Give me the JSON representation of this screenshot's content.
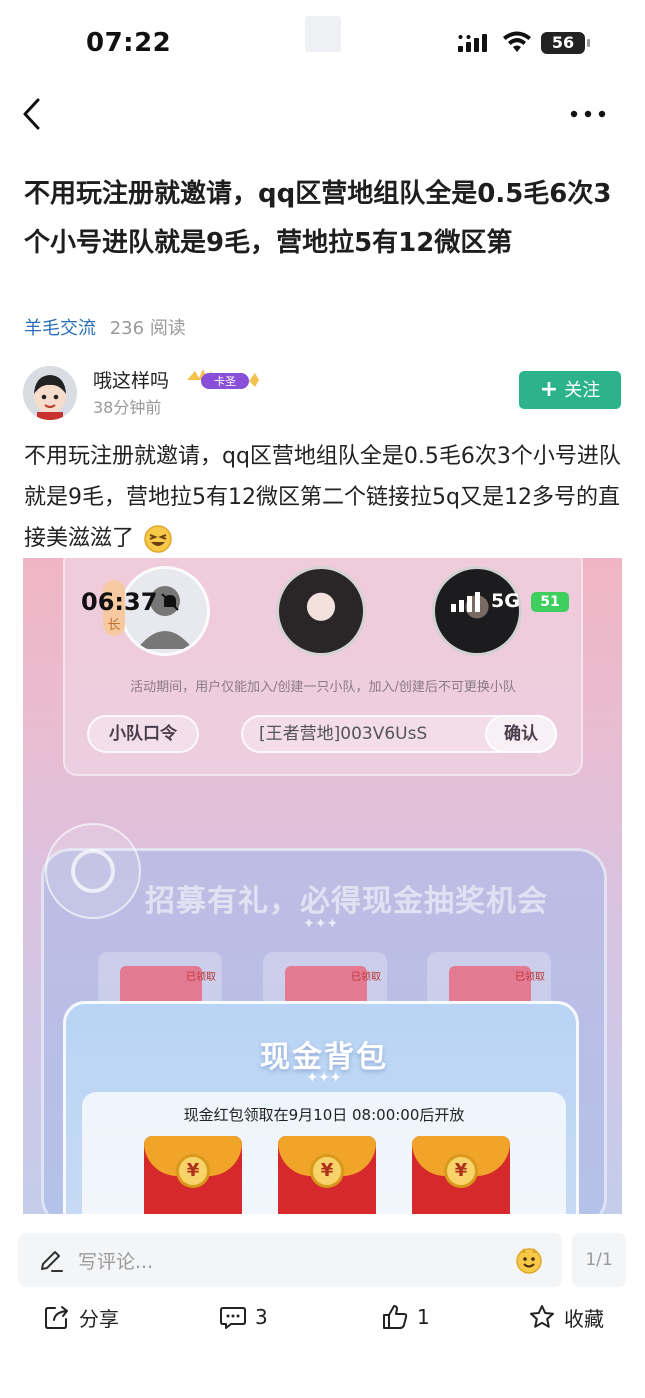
{
  "status_bar": {
    "time": "07:22",
    "battery": "56"
  },
  "post": {
    "title": "不用玩注册就邀请，qq区营地组队全是0.5毛6次3个小号进队就是9毛，营地拉5有12微区第",
    "category": "羊毛交流",
    "reads": "236 阅读",
    "author": {
      "name": "哦这样吗",
      "badge": "卡圣",
      "time": "38分钟前"
    },
    "follow_label": "关注",
    "body": "不用玩注册就邀请，qq区营地组队全是0.5毛6次3个小号进队就是9毛，营地拉5有12微区第二个链接拉5q又是12多号的直接美滋滋了"
  },
  "embedded_screenshot": {
    "time": "06:37",
    "network": "5G",
    "battery": "51",
    "leader_tag": "长",
    "note": "活动期间，用户仅能加入/创建一只小队，加入/创建后不可更换小队",
    "code_label": "小队口令",
    "code_value": "[王者营地]003V6UsS",
    "confirm_label": "确认",
    "recruit_title": "招募有礼，必得现金抽奖机会",
    "dots": "✦✦✦",
    "claimed_label": "已领取",
    "modal_title": "现金背包",
    "modal_note": "现金红包领取在9月10日 08:00:00后开放",
    "coin_symbol": "¥"
  },
  "comment": {
    "placeholder": "写评论...",
    "page_counter": "1/1"
  },
  "actions": {
    "share": "分享",
    "comments": "3",
    "likes": "1",
    "favorite": "收藏"
  },
  "colors": {
    "accent_green": "#2db38b",
    "link_blue": "#2a6fb5"
  }
}
